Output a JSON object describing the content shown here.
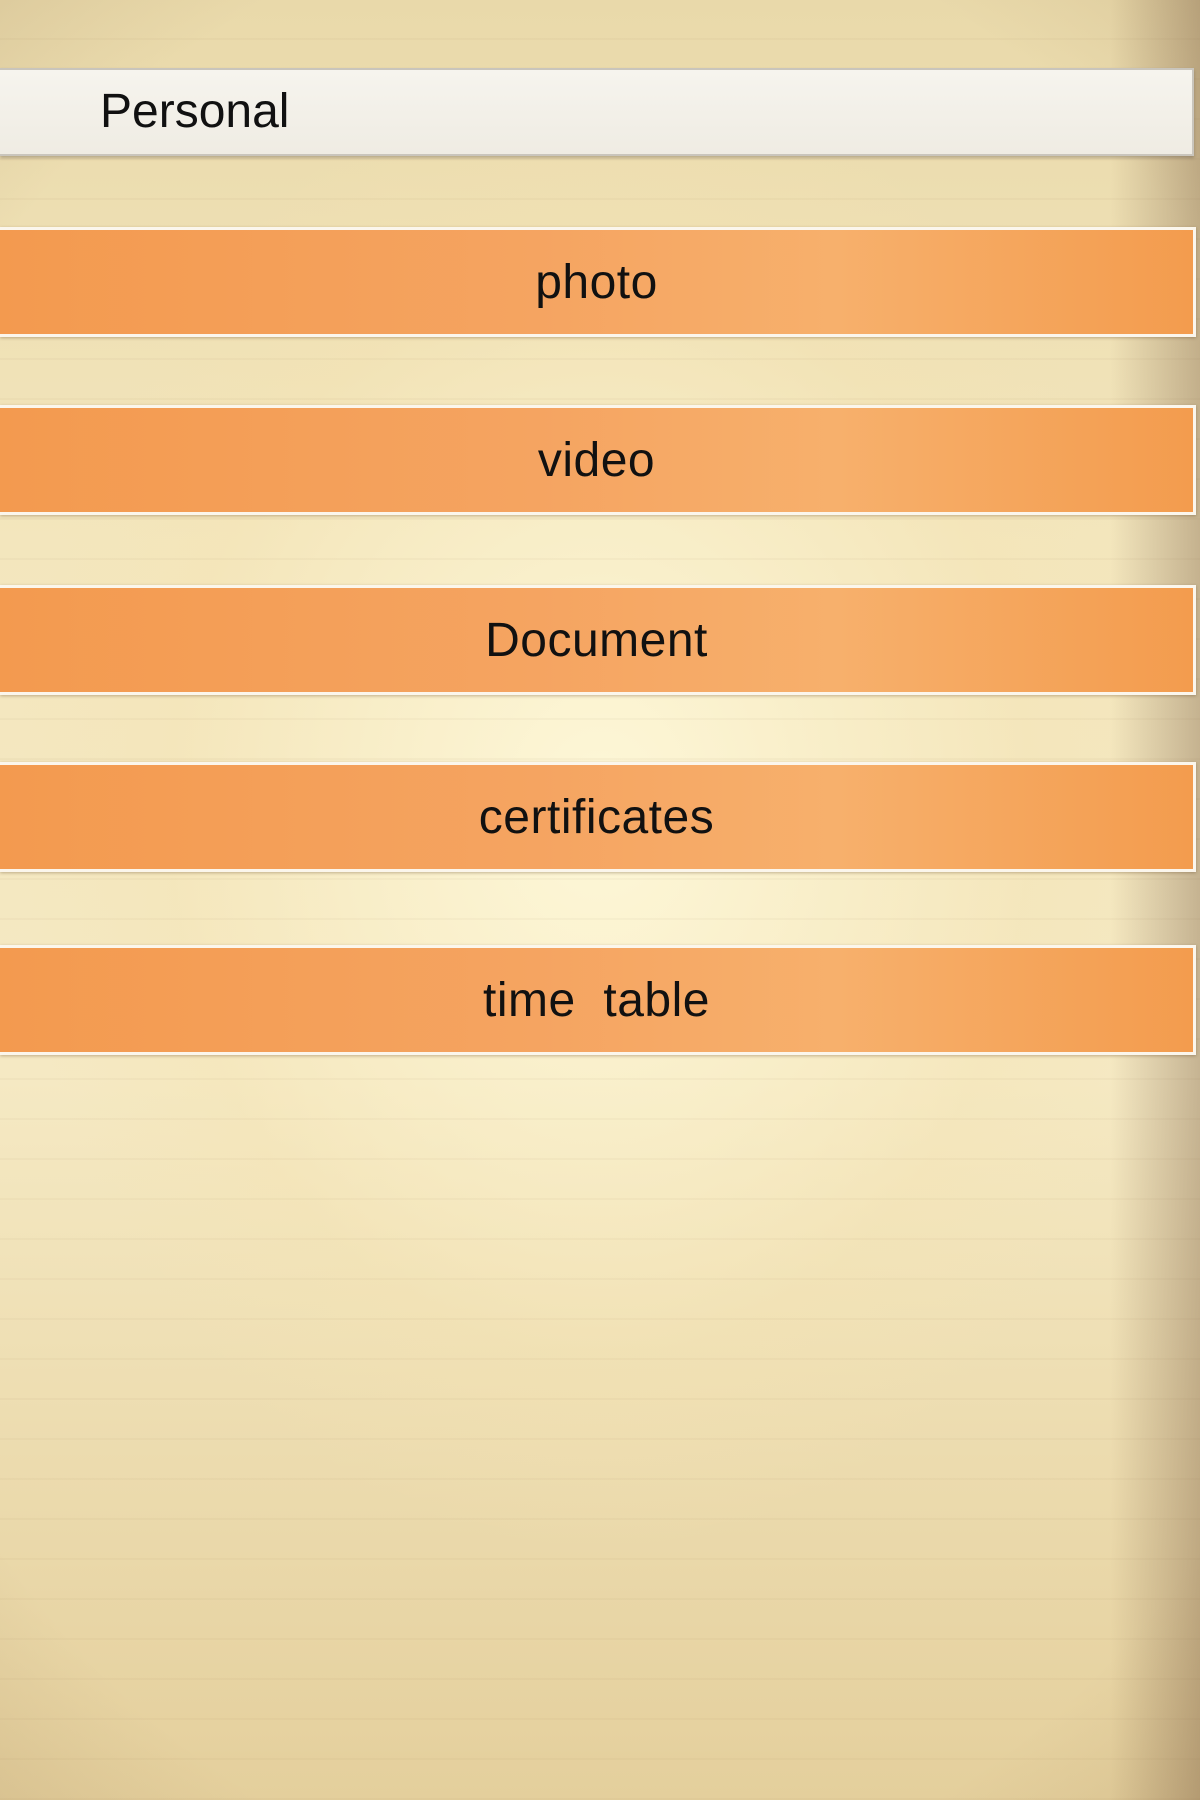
{
  "header": {
    "title": "Personal"
  },
  "menu": {
    "items": [
      {
        "label": "photo"
      },
      {
        "label": "video"
      },
      {
        "label": "Document"
      },
      {
        "label": "certificates"
      },
      {
        "label": "time  table"
      }
    ]
  },
  "colors": {
    "button_fill": "#f5a461",
    "button_border": "#fbf6ec",
    "header_fill": "#f6f4ee",
    "text": "#111111"
  }
}
